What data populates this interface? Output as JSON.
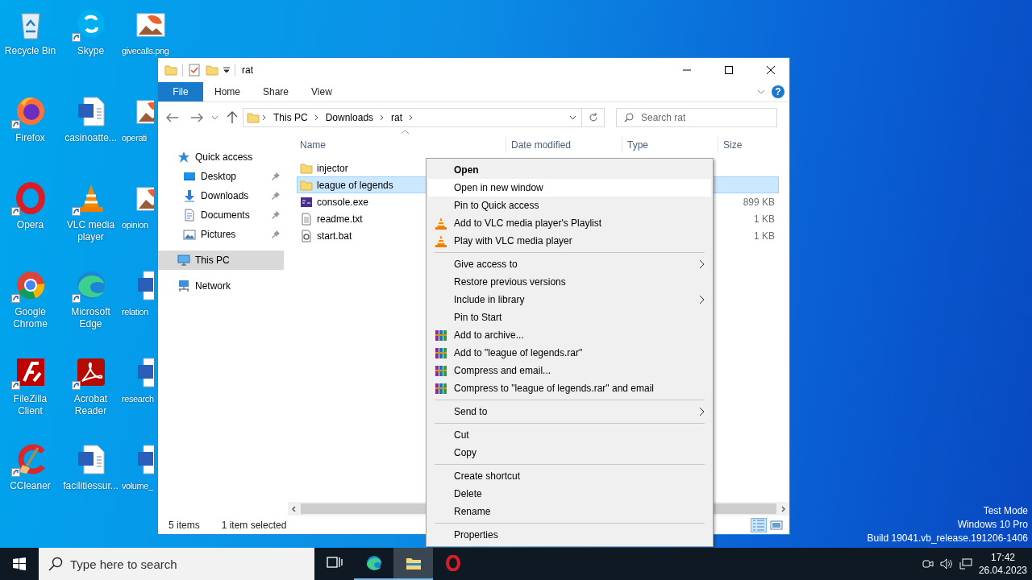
{
  "desktop": {
    "icons": [
      {
        "label": "Recycle Bin",
        "kind": "recycle",
        "shortcut": false
      },
      {
        "label": "Firefox",
        "kind": "firefox",
        "shortcut": true
      },
      {
        "label": "Opera",
        "kind": "opera",
        "shortcut": true
      },
      {
        "label": "Google Chrome",
        "kind": "chrome",
        "shortcut": true
      },
      {
        "label": "FileZilla Client",
        "kind": "filezilla",
        "shortcut": true
      },
      {
        "label": "CCleaner",
        "kind": "ccleaner",
        "shortcut": true
      },
      {
        "label": "Skype",
        "kind": "skype",
        "shortcut": true
      },
      {
        "label": "casinoatte...",
        "kind": "word",
        "shortcut": false
      },
      {
        "label": "VLC media player",
        "kind": "vlc",
        "shortcut": true
      },
      {
        "label": "Microsoft Edge",
        "kind": "edge",
        "shortcut": true
      },
      {
        "label": "Acrobat Reader",
        "kind": "acrobat",
        "shortcut": true
      },
      {
        "label": "facilitiessur...",
        "kind": "word",
        "shortcut": false
      },
      {
        "label": "givecalls.png",
        "kind": "image",
        "shortcut": false
      },
      {
        "label": "operati",
        "kind": "image",
        "shortcut": false
      },
      {
        "label": "opinion",
        "kind": "image",
        "shortcut": false
      },
      {
        "label": "relation",
        "kind": "word",
        "shortcut": false
      },
      {
        "label": "research",
        "kind": "word",
        "shortcut": false
      },
      {
        "label": "volume_",
        "kind": "word",
        "shortcut": false
      }
    ]
  },
  "explorer": {
    "window": {
      "title": "rat"
    },
    "ribbon_tabs": [
      {
        "label": "File",
        "kind": "file"
      },
      {
        "label": "Home",
        "kind": "tab"
      },
      {
        "label": "Share",
        "kind": "tab"
      },
      {
        "label": "View",
        "kind": "tab"
      }
    ],
    "help": "?",
    "address": {
      "path": [
        "This PC",
        "Downloads",
        "rat"
      ]
    },
    "search": {
      "placeholder": "Search rat"
    },
    "navigation": {
      "items": [
        {
          "label": "Quick access",
          "kind": "star",
          "selected": false,
          "children": [
            {
              "label": "Desktop",
              "kind": "desktop",
              "pinned": true,
              "selected": false
            },
            {
              "label": "Downloads",
              "kind": "download",
              "pinned": true,
              "selected": false
            },
            {
              "label": "Documents",
              "kind": "document",
              "pinned": true,
              "selected": false
            },
            {
              "label": "Pictures",
              "kind": "picture",
              "pinned": true,
              "selected": false
            }
          ]
        },
        {
          "label": "This PC",
          "kind": "pc",
          "selected": true
        },
        {
          "label": "Network",
          "kind": "network",
          "selected": false
        }
      ]
    },
    "columns": [
      {
        "label": "Name",
        "sorted": true
      },
      {
        "label": "Date modified"
      },
      {
        "label": "Type"
      },
      {
        "label": "Size"
      }
    ],
    "rows": [
      {
        "name": "injector",
        "kind": "folder",
        "selected": false
      },
      {
        "name": "league of legends",
        "kind": "folder",
        "selected": true
      },
      {
        "name": "console.exe",
        "kind": "exe",
        "size": "899 KB",
        "selected": false
      },
      {
        "name": "readme.txt",
        "kind": "text",
        "size": "1 KB",
        "selected": false
      },
      {
        "name": "start.bat",
        "kind": "batch",
        "size": "1 KB",
        "selected": false
      }
    ],
    "status_bar": {
      "count": "5 items",
      "selection": "1 item selected",
      "views": [
        {
          "kind": "details",
          "selected": true
        },
        {
          "kind": "preview",
          "selected": false
        }
      ]
    }
  },
  "context_menu": {
    "items": [
      {
        "kind": "item",
        "label": "Open",
        "default": true,
        "selected": false,
        "submenu": false
      },
      {
        "kind": "item",
        "label": "Open in new window",
        "default": false,
        "selected": true,
        "submenu": false
      },
      {
        "kind": "item",
        "label": "Pin to Quick access",
        "default": false,
        "selected": false,
        "submenu": false
      },
      {
        "kind": "vlc",
        "label": "Add to VLC media player's Playlist",
        "default": false,
        "selected": false,
        "submenu": false
      },
      {
        "kind": "vlc",
        "label": "Play with VLC media player",
        "default": false,
        "selected": false,
        "submenu": false
      },
      {
        "kind": "separator"
      },
      {
        "kind": "item",
        "label": "Give access to",
        "default": false,
        "selected": false,
        "submenu": true
      },
      {
        "kind": "item",
        "label": "Restore previous versions",
        "default": false,
        "selected": false,
        "submenu": false
      },
      {
        "kind": "item",
        "label": "Include in library",
        "default": false,
        "selected": false,
        "submenu": true
      },
      {
        "kind": "item",
        "label": "Pin to Start",
        "default": false,
        "selected": false,
        "submenu": false
      },
      {
        "kind": "rar",
        "label": "Add to archive...",
        "default": false,
        "selected": false,
        "submenu": false
      },
      {
        "kind": "rar",
        "label": "Add to \"league of legends.rar\"",
        "default": false,
        "selected": false,
        "submenu": false
      },
      {
        "kind": "rar",
        "label": "Compress and email...",
        "default": false,
        "selected": false,
        "submenu": false
      },
      {
        "kind": "rar",
        "label": "Compress to \"league of legends.rar\" and email",
        "default": false,
        "selected": false,
        "submenu": false
      },
      {
        "kind": "separator"
      },
      {
        "kind": "item",
        "label": "Send to",
        "default": false,
        "selected": false,
        "submenu": true
      },
      {
        "kind": "separator"
      },
      {
        "kind": "item",
        "label": "Cut",
        "default": false,
        "selected": false,
        "submenu": false
      },
      {
        "kind": "item",
        "label": "Copy",
        "default": false,
        "selected": false,
        "submenu": false
      },
      {
        "kind": "separator"
      },
      {
        "kind": "item",
        "label": "Create shortcut",
        "default": false,
        "selected": false,
        "submenu": false
      },
      {
        "kind": "item",
        "label": "Delete",
        "default": false,
        "selected": false,
        "submenu": false
      },
      {
        "kind": "item",
        "label": "Rename",
        "default": false,
        "selected": false,
        "submenu": false
      },
      {
        "kind": "separator"
      },
      {
        "kind": "item",
        "label": "Properties",
        "default": false,
        "selected": false,
        "submenu": false
      }
    ]
  },
  "watermark": [
    "Test Mode",
    "Windows 10 Pro",
    "Build 19041.vb_release.191206-1406"
  ],
  "taskbar": {
    "search": {
      "placeholder": "Type here to search"
    },
    "apps": [
      {
        "kind": "task-view",
        "running": false,
        "active": false
      },
      {
        "kind": "edge",
        "running": true,
        "active": false
      },
      {
        "kind": "explorer",
        "running": true,
        "active": true
      },
      {
        "kind": "opera",
        "running": false,
        "active": false
      }
    ],
    "clock": {
      "time": "17:42",
      "date": "26.04.2023"
    }
  }
}
